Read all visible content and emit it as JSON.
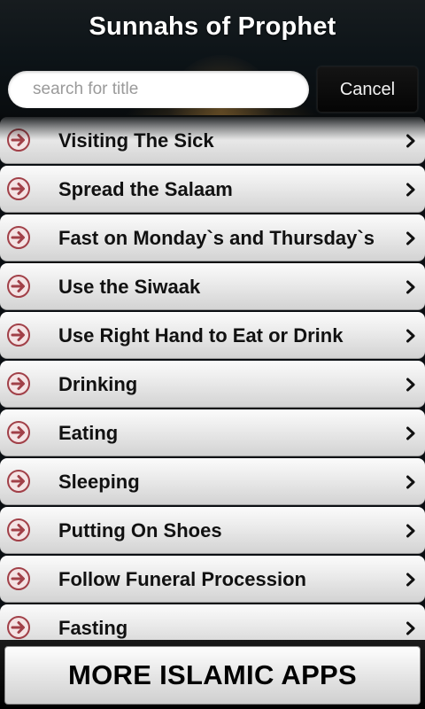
{
  "header": {
    "title": "Sunnahs of Prophet"
  },
  "search": {
    "placeholder": "search for title",
    "value": "",
    "cancel_label": "Cancel"
  },
  "list": {
    "items": [
      {
        "label": "Visiting The Sick"
      },
      {
        "label": "Spread the Salaam"
      },
      {
        "label": "Fast on Monday`s and Thursday`s"
      },
      {
        "label": "Use the Siwaak"
      },
      {
        "label": "Use Right Hand to Eat or Drink"
      },
      {
        "label": "Drinking"
      },
      {
        "label": "Eating"
      },
      {
        "label": "Sleeping"
      },
      {
        "label": "Putting On Shoes"
      },
      {
        "label": "Follow Funeral Procession"
      },
      {
        "label": "Fasting"
      }
    ],
    "leading_icon": "circle-arrow-right-icon",
    "trailing_icon": "chevron-right-icon"
  },
  "footer": {
    "more_apps_label": "MORE ISLAMIC APPS"
  },
  "colors": {
    "arrow_icon": "#a14048",
    "header_bg": "#0d1418",
    "list_row_top": "#fbfbfb",
    "list_row_bottom": "#d3d3d3"
  }
}
